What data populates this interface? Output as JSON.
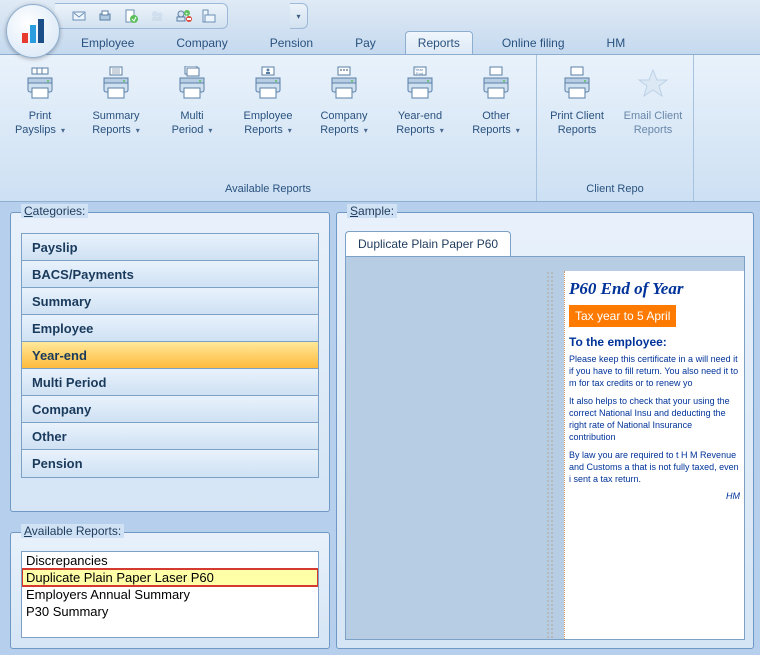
{
  "tabs": [
    "Employee",
    "Company",
    "Pension",
    "Pay",
    "Reports",
    "Online filing",
    "HM"
  ],
  "active_tab": "Reports",
  "ribbon": {
    "group1": {
      "caption": "Available Reports",
      "items": [
        {
          "l1": "Print",
          "l2": "Payslips",
          "dd": true
        },
        {
          "l1": "Summary",
          "l2": "Reports",
          "dd": true
        },
        {
          "l1": "Multi",
          "l2": "Period",
          "dd": true
        },
        {
          "l1": "Employee",
          "l2": "Reports",
          "dd": true
        },
        {
          "l1": "Company",
          "l2": "Reports",
          "dd": true
        },
        {
          "l1": "Year-end",
          "l2": "Reports",
          "dd": true
        },
        {
          "l1": "Other",
          "l2": "Reports",
          "dd": true
        }
      ]
    },
    "group2": {
      "caption": "Client Repo",
      "items": [
        {
          "l1": "Print Client",
          "l2": "Reports",
          "dd": false
        },
        {
          "l1": "Email Client",
          "l2": "Reports",
          "dd": false,
          "disabled": true
        }
      ]
    }
  },
  "categories": {
    "legend": "Categories:",
    "items": [
      "Payslip",
      "BACS/Payments",
      "Summary",
      "Employee",
      "Year-end",
      "Multi Period",
      "Company",
      "Other",
      "Pension"
    ],
    "selected": "Year-end"
  },
  "available": {
    "legend": "Available Reports:",
    "items": [
      "Discrepancies",
      "Duplicate Plain Paper Laser P60",
      "Employers Annual Summary",
      "P30 Summary"
    ],
    "highlighted": "Duplicate Plain Paper Laser P60"
  },
  "sample": {
    "legend": "Sample:",
    "tab": "Duplicate Plain Paper P60",
    "doc": {
      "title": "P60 End of Year",
      "band": "Tax year to 5 April",
      "h": "To the employee:",
      "p1": "Please keep this certificate in a will need it if you have to fill return. You also need it to m for tax credits or to renew yo",
      "p2": "It also helps to check that your using the correct National Insu and deducting the right rate of National Insurance contribution",
      "p3": "By law you are required to t H M Revenue and Customs a that is not fully taxed, even i sent a tax return.",
      "sig": "HM"
    }
  }
}
